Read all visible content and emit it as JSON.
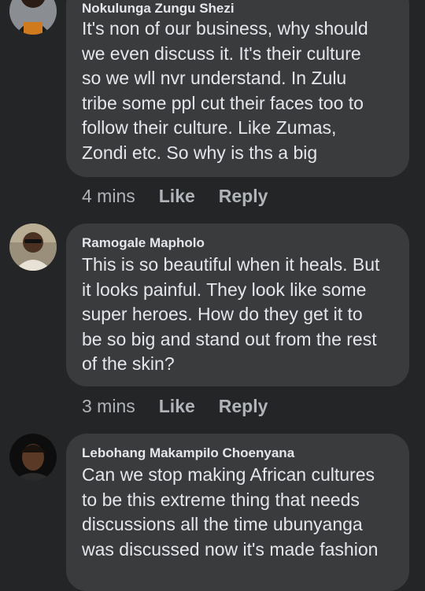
{
  "comments": [
    {
      "author": "Nokulunga Zungu Shezi",
      "lines": [
        "It's non of our business, why should",
        "we even discuss it. It's their culture",
        "so we wll nvr understand. In Zulu",
        "tribe some ppl cut their faces too to",
        "follow their culture. Like Zumas,",
        "Zondi etc. So why is ths a big"
      ],
      "time": "4 mins",
      "like": "Like",
      "reply": "Reply"
    },
    {
      "author": "Ramogale Mapholo",
      "lines": [
        "This is so beautiful when it heals. But",
        "it looks painful. They look like some",
        "super heroes. How do they get it to",
        "be so big and stand out from the rest",
        "of the skin?"
      ],
      "time": "3 mins",
      "like": "Like",
      "reply": "Reply"
    },
    {
      "author": "Lebohang Makampilo Choenyana",
      "lines": [
        "Can we stop making African cultures",
        "to be this extreme thing that needs",
        "discussions all the time ubunyanga",
        "was discussed now it's made fashion"
      ]
    }
  ],
  "colors": {
    "background": "#242526",
    "bubble": "#3a3b3c",
    "text": "#e4e6eb",
    "secondary": "#b0b3b8"
  }
}
